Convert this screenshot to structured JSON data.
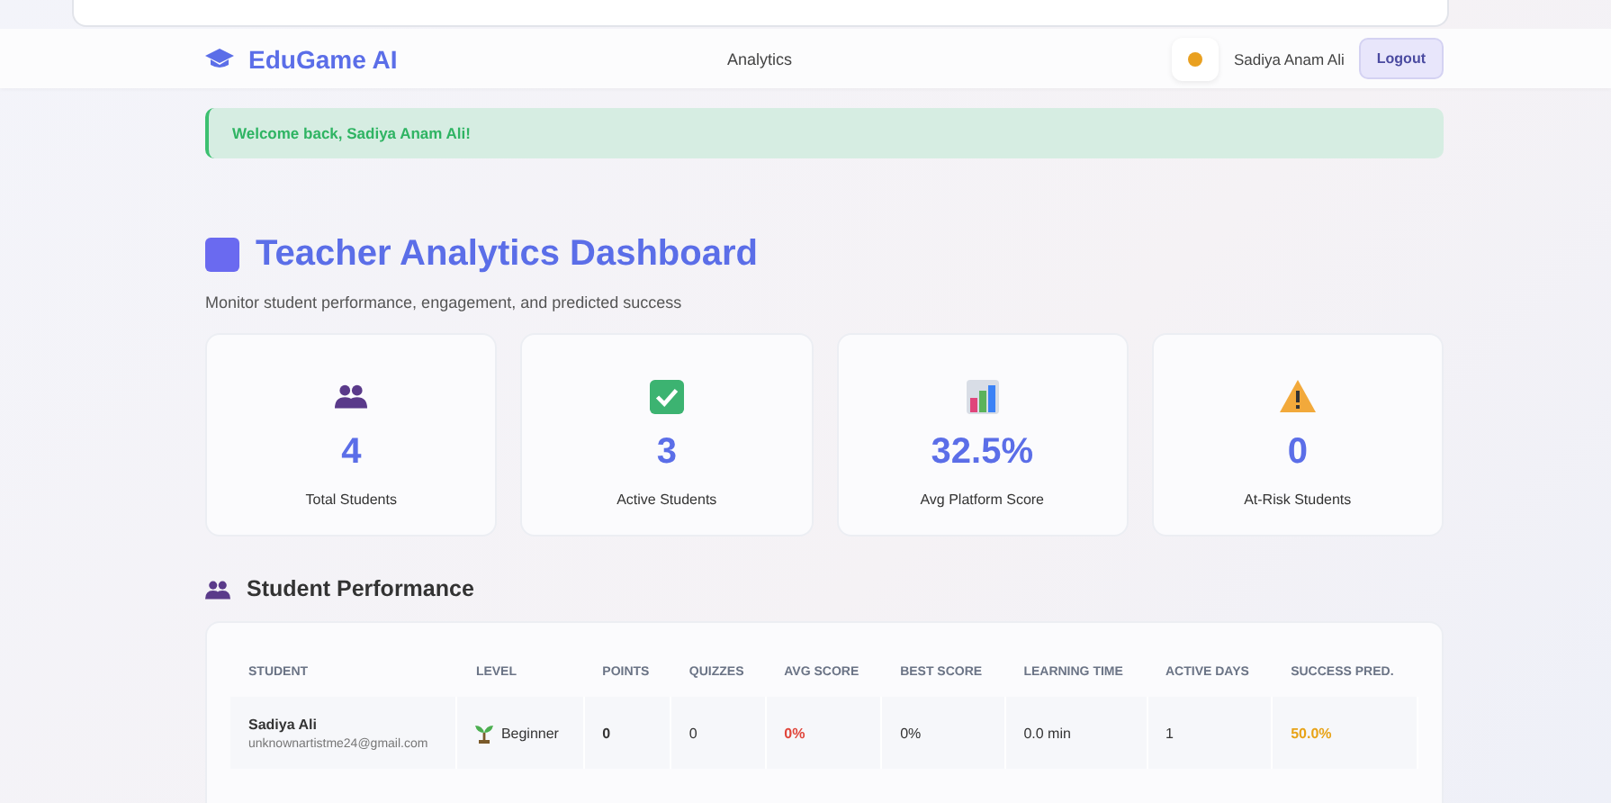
{
  "navbar": {
    "brand": "EduGame AI",
    "links": [
      {
        "label": "Analytics"
      }
    ],
    "user_name": "Sadiya Anam Ali",
    "logout": "Logout"
  },
  "alert": {
    "message": "Welcome back, Sadiya Anam Ali!"
  },
  "page": {
    "title": "Teacher Analytics Dashboard",
    "subtitle": "Monitor student performance, engagement, and predicted success"
  },
  "stats": [
    {
      "kind": "people",
      "value": "4",
      "label": "Total Students"
    },
    {
      "kind": "check",
      "value": "3",
      "label": "Active Students"
    },
    {
      "kind": "chart",
      "value": "32.5%",
      "label": "Avg Platform Score"
    },
    {
      "kind": "warning",
      "value": "0",
      "label": "At-Risk Students"
    }
  ],
  "performance": {
    "title": "Student Performance",
    "columns": [
      "STUDENT",
      "LEVEL",
      "POINTS",
      "QUIZZES",
      "AVG SCORE",
      "BEST SCORE",
      "LEARNING TIME",
      "ACTIVE DAYS",
      "SUCCESS PRED."
    ],
    "rows": [
      {
        "name": "Sadiya Ali",
        "email": "unknownartistme24@gmail.com",
        "level": "Beginner",
        "points": "0",
        "quizzes": "0",
        "avg_score": {
          "text": "0%",
          "color": "#e0453a"
        },
        "best_score": "0%",
        "learning_time": "0.0 min",
        "active_days": "1",
        "success_pred": {
          "text": "50.0%",
          "color": "#e8a317"
        }
      }
    ]
  }
}
